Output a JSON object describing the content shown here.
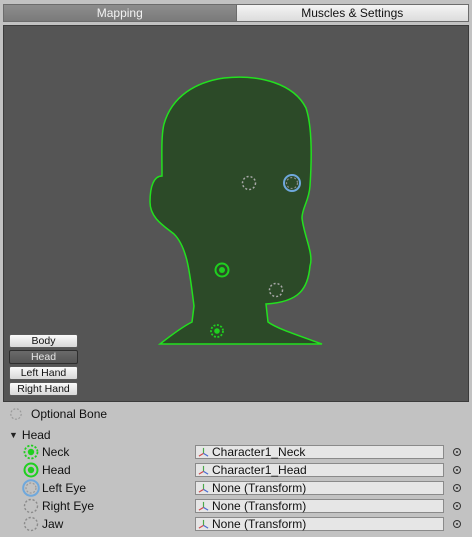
{
  "tabs": {
    "mapping": "Mapping",
    "muscles": "Muscles & Settings"
  },
  "body_parts": {
    "body": "Body",
    "head": "Head",
    "left_hand": "Left Hand",
    "right_hand": "Right Hand",
    "selected": "Head"
  },
  "legend": {
    "optional_bone": "Optional Bone"
  },
  "section": {
    "title": "Head",
    "expanded": true
  },
  "bones": [
    {
      "name": "Neck",
      "value": "Character1_Neck",
      "status": "mapped-optional"
    },
    {
      "name": "Head",
      "value": "Character1_Head",
      "status": "mapped-required"
    },
    {
      "name": "Left Eye",
      "value": "None (Transform)",
      "status": "selected-empty"
    },
    {
      "name": "Right Eye",
      "value": "None (Transform)",
      "status": "empty-optional"
    },
    {
      "name": "Jaw",
      "value": "None (Transform)",
      "status": "empty-optional"
    }
  ],
  "colors": {
    "mapped": "#1fcf1f",
    "selected": "#6fa8dc",
    "empty": "#9a9a9a",
    "silhouette_fill": "#2c4a28",
    "silhouette_outline": "#23e01f"
  }
}
